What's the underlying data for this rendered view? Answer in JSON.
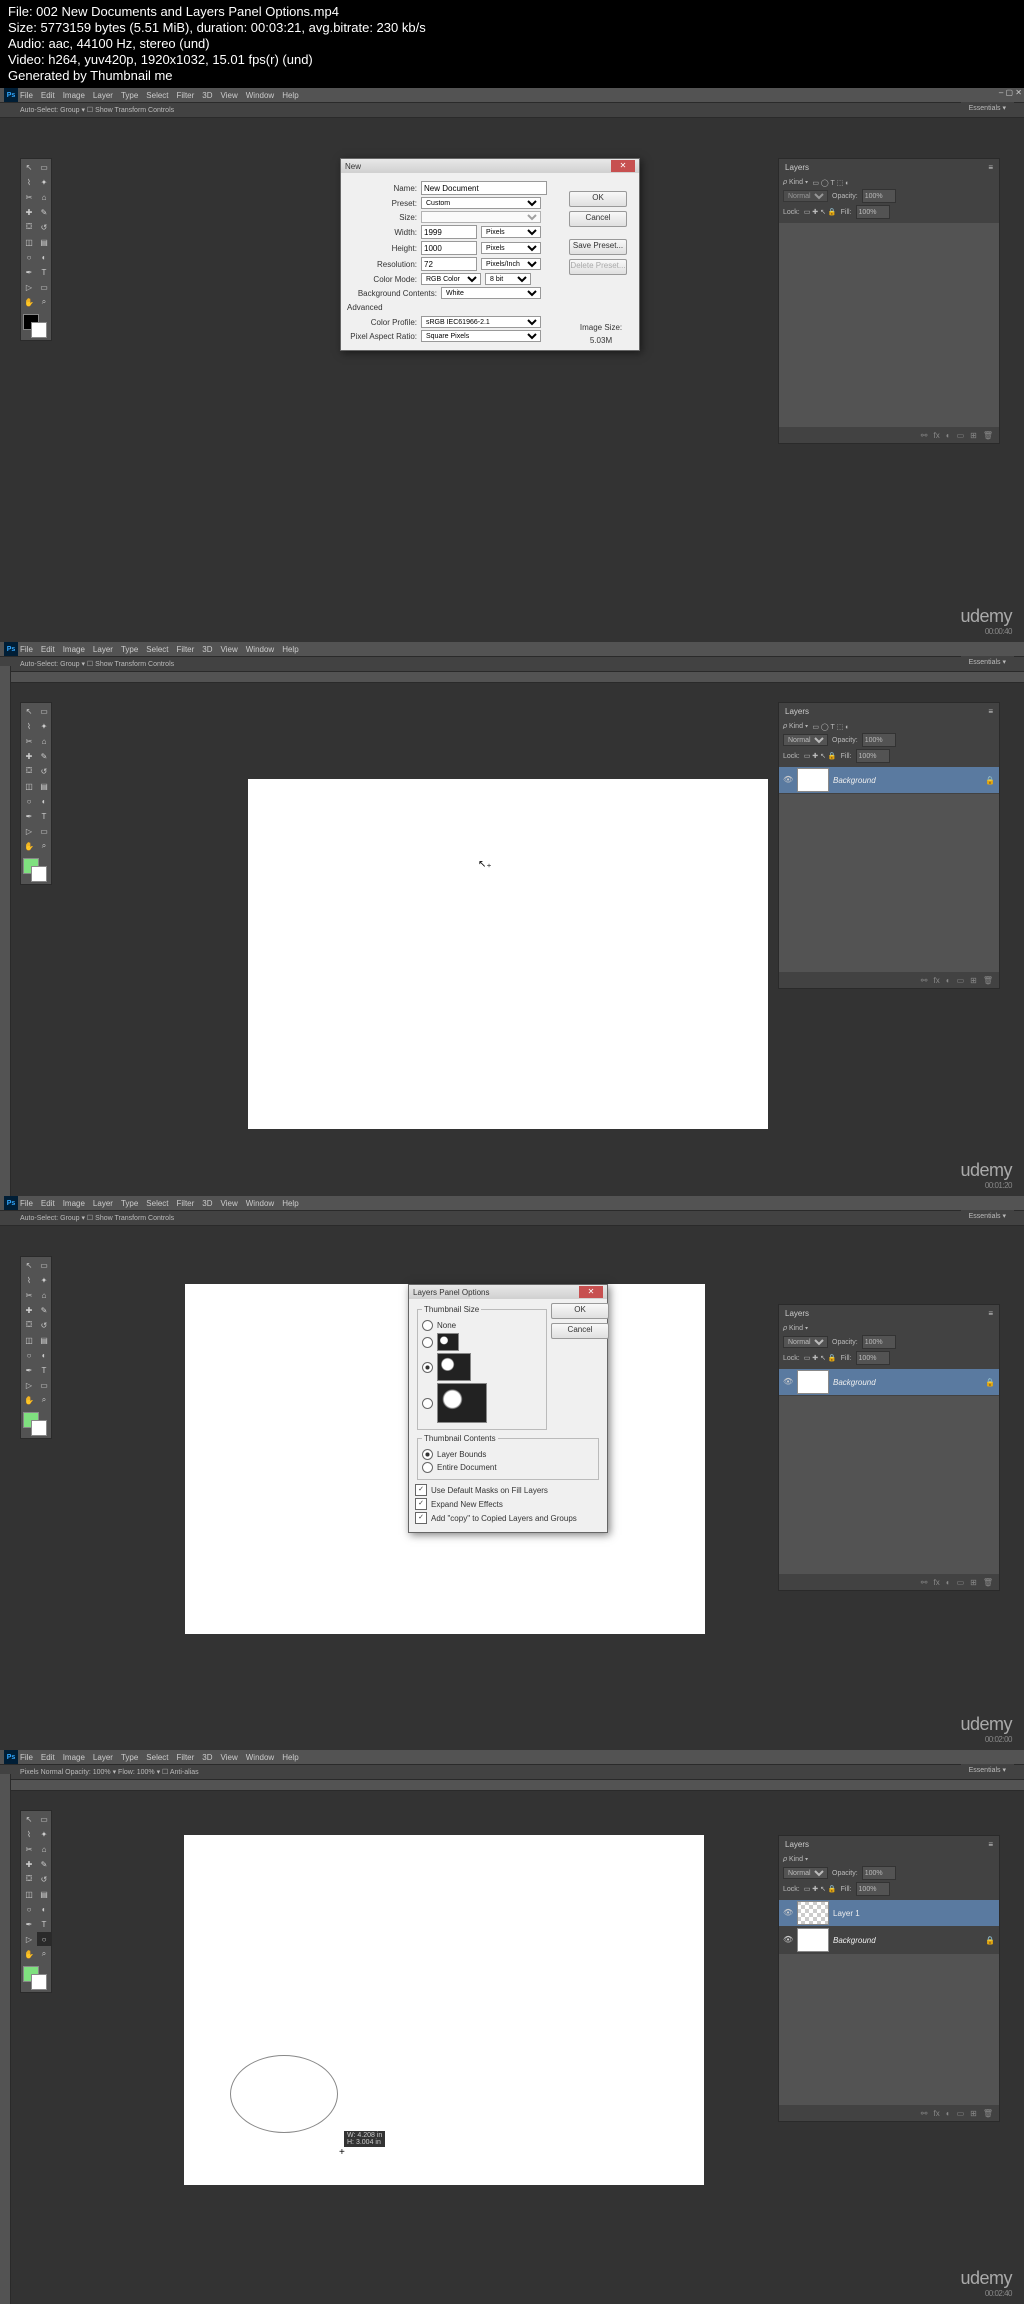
{
  "meta": {
    "file": "File: 002 New Documents and Layers Panel Options.mp4",
    "size": "Size: 5773159 bytes (5.51 MiB), duration: 00:03:21, avg.bitrate: 230 kb/s",
    "audio": "Audio: aac, 44100 Hz, stereo (und)",
    "video": "Video: h264, yuv420p, 1920x1032, 15.01 fps(r) (und)",
    "gen": "Generated by Thumbnail me"
  },
  "menu": [
    "File",
    "Edit",
    "Image",
    "Layer",
    "Type",
    "Select",
    "Filter",
    "3D",
    "View",
    "Window",
    "Help"
  ],
  "options1": "Auto-Select:   Group ▾   ☐ Show Transform Controls",
  "options4": "Pixels   Normal    Opacity: 100% ▾   Flow: 100% ▾   ☐ Anti-alias",
  "essentials": "Essentials ▾",
  "ps": "Ps",
  "layers": {
    "title": "Layers",
    "normal": "Normal",
    "opacity_lbl": "Opacity:",
    "opacity": "100%",
    "lock_lbl": "Lock:",
    "fill_lbl": "Fill:",
    "fill": "100%",
    "bg": "Background",
    "l1": "Layer 1"
  },
  "udemy": "udemy",
  "ts1": "00:00:40",
  "ts2": "00:01:20",
  "ts3": "00:02:00",
  "ts4": "00:02:40",
  "newdoc": {
    "title": "New",
    "name_lbl": "Name:",
    "name": "New Document",
    "preset_lbl": "Preset:",
    "preset": "Custom",
    "size_lbl": "Size:",
    "width_lbl": "Width:",
    "width": "1999",
    "width_u": "Pixels",
    "height_lbl": "Height:",
    "height": "1000",
    "height_u": "Pixels",
    "res_lbl": "Resolution:",
    "res": "72",
    "res_u": "Pixels/Inch",
    "cmode_lbl": "Color Mode:",
    "cmode": "RGB Color",
    "cbits": "8 bit",
    "bgc_lbl": "Background Contents:",
    "bgc": "White",
    "advanced": "Advanced",
    "cprof_lbl": "Color Profile:",
    "cprof": "sRGB IEC61966-2.1",
    "par_lbl": "Pixel Aspect Ratio:",
    "par": "Square Pixels",
    "ok": "OK",
    "cancel": "Cancel",
    "save_preset": "Save Preset...",
    "del_preset": "Delete Preset...",
    "imgsize_lbl": "Image Size:",
    "imgsize": "5.03M"
  },
  "lpo": {
    "title": "Layers Panel Options",
    "tsize": "Thumbnail Size",
    "none": "None",
    "tcontents": "Thumbnail Contents",
    "lbounds": "Layer Bounds",
    "edoc": "Entire Document",
    "c1": "Use Default Masks on Fill Layers",
    "c2": "Expand New Effects",
    "c3": "Add \"copy\" to Copied Layers and Groups",
    "ok": "OK",
    "cancel": "Cancel"
  },
  "dims_tip": {
    "w": "W: 4.208 in",
    "h": "H: 3.004 in"
  }
}
